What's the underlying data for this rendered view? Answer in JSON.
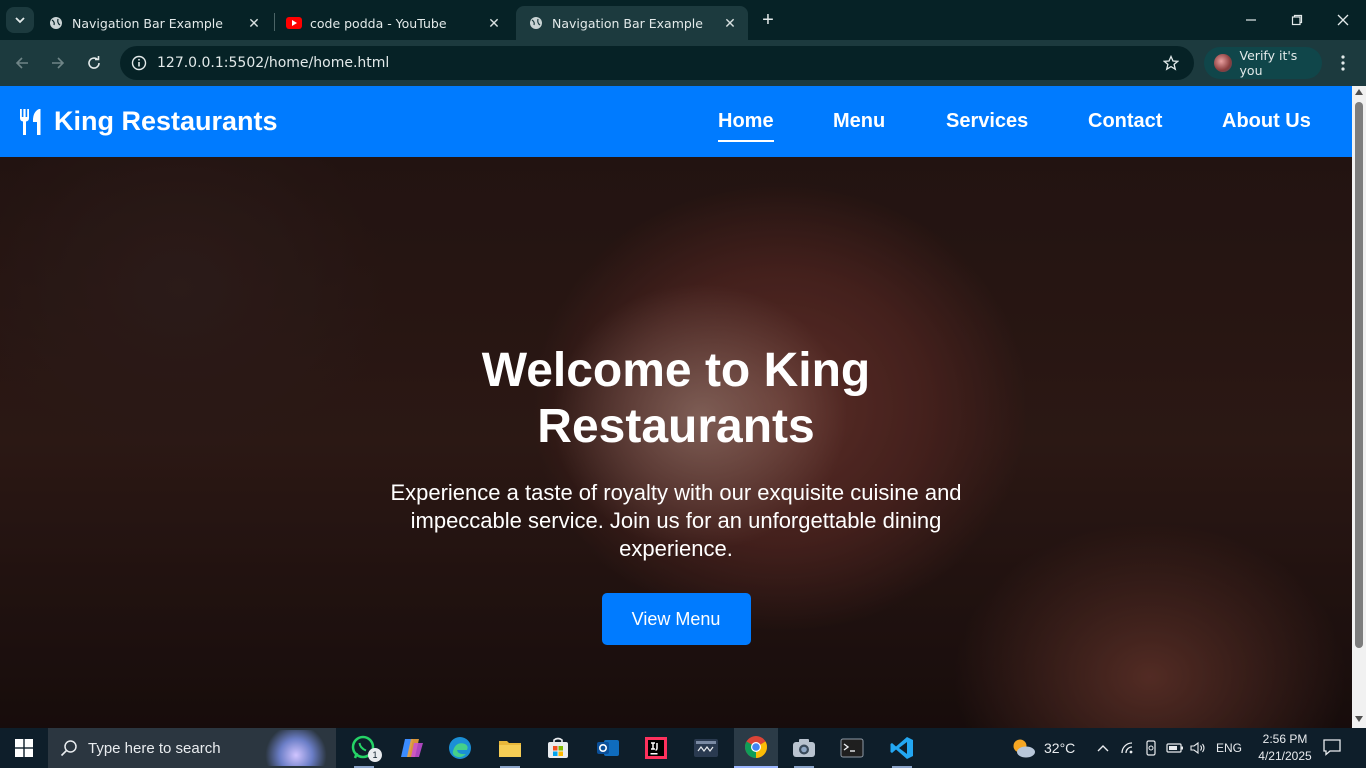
{
  "browser": {
    "tabs": [
      {
        "title": "Navigation Bar Example",
        "favicon": "globe-icon"
      },
      {
        "title": "code podda - YouTube",
        "favicon": "youtube-icon"
      },
      {
        "title": "Navigation Bar Example",
        "favicon": "globe-icon",
        "active": true
      }
    ],
    "url": "127.0.0.1:5502/home/home.html",
    "verify_label": "Verify it's you"
  },
  "page": {
    "brand": "King Restaurants",
    "nav": [
      {
        "label": "Home",
        "active": true
      },
      {
        "label": "Menu"
      },
      {
        "label": "Services"
      },
      {
        "label": "Contact"
      },
      {
        "label": "About Us"
      }
    ],
    "hero": {
      "title": "Welcome to King Restaurants",
      "text": "Experience a taste of royalty with our exquisite cuisine and impeccable service. Join us for an unforgettable dining experience.",
      "button": "View Menu"
    },
    "colors": {
      "accent": "#007bff"
    }
  },
  "taskbar": {
    "search_placeholder": "Type here to search",
    "whatsapp_badge": "1",
    "weather": "32°C",
    "language": "ENG",
    "time": "2:56 PM",
    "date": "4/21/2025"
  }
}
